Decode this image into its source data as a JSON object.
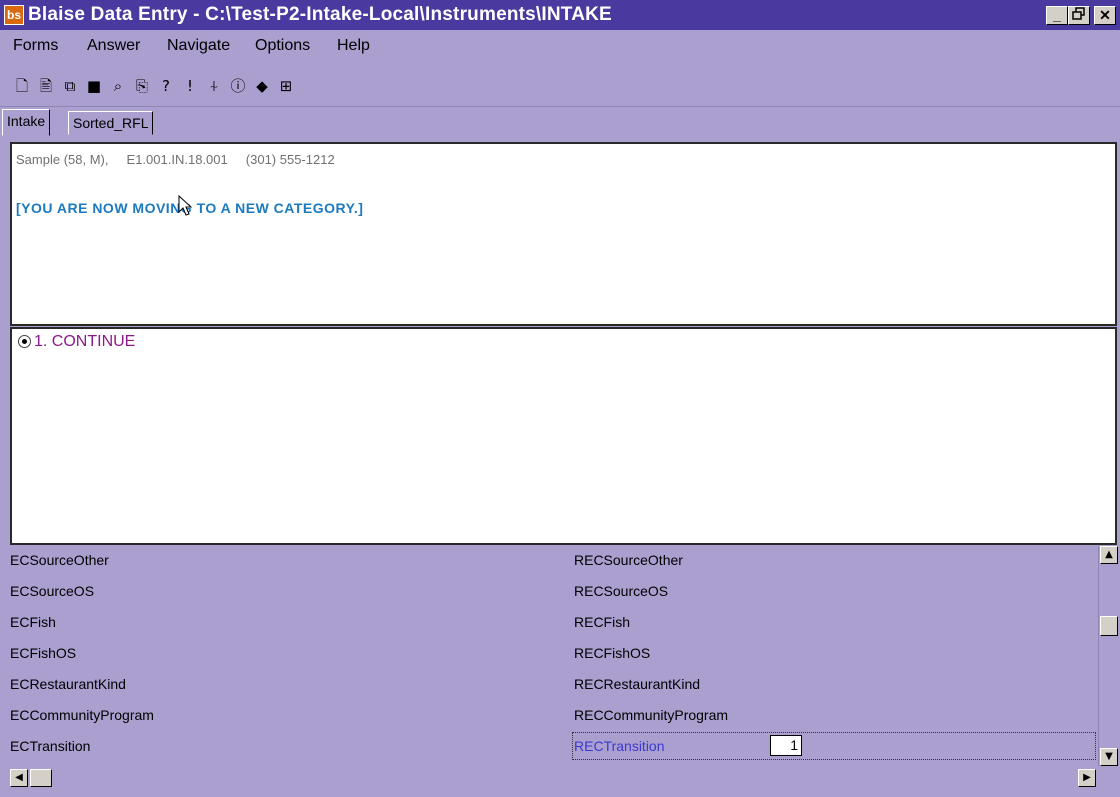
{
  "window": {
    "title": "Blaise Data Entry - C:\\Test-P2-Intake-Local\\Instruments\\INTAKE",
    "icon": "bs",
    "minimize": "_",
    "restore": "🗗",
    "close": "✕"
  },
  "menu": [
    "Forms",
    "Answer",
    "Navigate",
    "Options",
    "Help"
  ],
  "toolbar": [
    "new-form-icon",
    "open-form-icon",
    "copy-form-icon",
    "save-icon",
    "find-icon",
    "paste-icon",
    "help-icon",
    "watch-icon",
    "attach-icon",
    "info-icon",
    "remark-icon",
    "tree-icon"
  ],
  "tabs": [
    "Intake",
    "Sorted_RFL"
  ],
  "question": {
    "sample_info": "Sample (58, M),     E1.001.IN.18.001     (301) 555-1212",
    "text": "[YOU ARE NOW MOVING TO A NEW CATEGORY.]"
  },
  "answer": {
    "option": "1.  CONTINUE",
    "selected": true
  },
  "fields": [
    {
      "left": "ECSourceOther",
      "right": "RECSourceOther"
    },
    {
      "left": "ECSourceOS",
      "right": "RECSourceOS"
    },
    {
      "left": "ECFish",
      "right": "RECFish"
    },
    {
      "left": "ECFishOS",
      "right": "RECFishOS"
    },
    {
      "left": "ECRestaurantKind",
      "right": "RECRestaurantKind"
    },
    {
      "left": "ECCommunityProgram",
      "right": "RECCommunityProgram"
    },
    {
      "left": "ECTransition",
      "right": "RECTransition",
      "value": "1",
      "active": true
    }
  ]
}
